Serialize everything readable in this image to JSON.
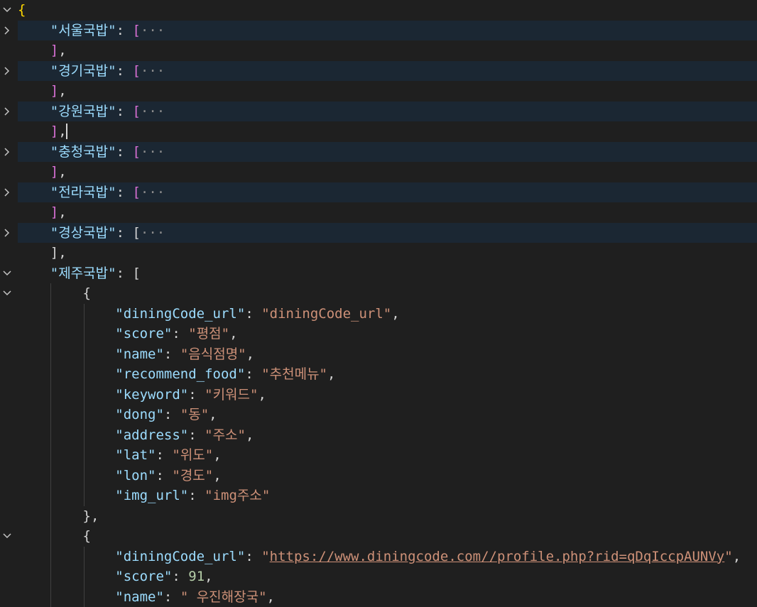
{
  "editor": {
    "lines": [
      {
        "fold": "open",
        "hl": false,
        "tokens": [
          {
            "t": "{",
            "c": "b1"
          }
        ]
      },
      {
        "fold": "closed",
        "hl": true,
        "tokens": [
          {
            "t": "    "
          },
          {
            "t": "\"서울국밥\"",
            "c": "key"
          },
          {
            "t": ": ",
            "c": "punc"
          },
          {
            "t": "[",
            "c": "b2"
          },
          {
            "t": "···",
            "c": "ell"
          }
        ]
      },
      {
        "fold": "",
        "hl": false,
        "tokens": [
          {
            "t": "    "
          },
          {
            "t": "]",
            "c": "b2"
          },
          {
            "t": ",",
            "c": "punc"
          }
        ]
      },
      {
        "fold": "closed",
        "hl": true,
        "tokens": [
          {
            "t": "    "
          },
          {
            "t": "\"경기국밥\"",
            "c": "key"
          },
          {
            "t": ": ",
            "c": "punc"
          },
          {
            "t": "[",
            "c": "b2"
          },
          {
            "t": "···",
            "c": "ell"
          }
        ]
      },
      {
        "fold": "",
        "hl": false,
        "tokens": [
          {
            "t": "    "
          },
          {
            "t": "]",
            "c": "b2"
          },
          {
            "t": ",",
            "c": "punc"
          }
        ]
      },
      {
        "fold": "closed",
        "hl": true,
        "tokens": [
          {
            "t": "    "
          },
          {
            "t": "\"강원국밥\"",
            "c": "key"
          },
          {
            "t": ": ",
            "c": "punc"
          },
          {
            "t": "[",
            "c": "b2"
          },
          {
            "t": "···",
            "c": "ell"
          }
        ]
      },
      {
        "fold": "",
        "hl": false,
        "cursor": true,
        "tokens": [
          {
            "t": "    "
          },
          {
            "t": "]",
            "c": "b2"
          },
          {
            "t": ",",
            "c": "punc"
          }
        ]
      },
      {
        "fold": "closed",
        "hl": true,
        "tokens": [
          {
            "t": "    "
          },
          {
            "t": "\"충청국밥\"",
            "c": "key"
          },
          {
            "t": ": ",
            "c": "punc"
          },
          {
            "t": "[",
            "c": "b2"
          },
          {
            "t": "···",
            "c": "ell"
          }
        ]
      },
      {
        "fold": "",
        "hl": false,
        "tokens": [
          {
            "t": "    "
          },
          {
            "t": "]",
            "c": "b2"
          },
          {
            "t": ",",
            "c": "punc"
          }
        ]
      },
      {
        "fold": "closed",
        "hl": true,
        "tokens": [
          {
            "t": "    "
          },
          {
            "t": "\"전라국밥\"",
            "c": "key"
          },
          {
            "t": ": ",
            "c": "punc"
          },
          {
            "t": "[",
            "c": "b2"
          },
          {
            "t": "···",
            "c": "ell"
          }
        ]
      },
      {
        "fold": "",
        "hl": false,
        "tokens": [
          {
            "t": "    "
          },
          {
            "t": "]",
            "c": "b2"
          },
          {
            "t": ",",
            "c": "punc"
          }
        ]
      },
      {
        "fold": "closed",
        "hl": true,
        "tokens": [
          {
            "t": "    "
          },
          {
            "t": "\"경상국밥\"",
            "c": "key"
          },
          {
            "t": ": ",
            "c": "punc"
          },
          {
            "t": "[",
            "c": "b3"
          },
          {
            "t": "···",
            "c": "ell"
          }
        ]
      },
      {
        "fold": "",
        "hl": false,
        "tokens": [
          {
            "t": "    "
          },
          {
            "t": "]",
            "c": "b3"
          },
          {
            "t": ",",
            "c": "punc"
          }
        ]
      },
      {
        "fold": "open",
        "hl": false,
        "tokens": [
          {
            "t": "    "
          },
          {
            "t": "\"제주국밥\"",
            "c": "key"
          },
          {
            "t": ": ",
            "c": "punc"
          },
          {
            "t": "[",
            "c": "b3"
          }
        ]
      },
      {
        "fold": "open",
        "hl": false,
        "tokens": [
          {
            "t": "        "
          },
          {
            "t": "{",
            "c": "b3"
          }
        ]
      },
      {
        "fold": "",
        "hl": false,
        "tokens": [
          {
            "t": "            "
          },
          {
            "t": "\"diningCode_url\"",
            "c": "key"
          },
          {
            "t": ": ",
            "c": "punc"
          },
          {
            "t": "\"diningCode_url\"",
            "c": "str"
          },
          {
            "t": ",",
            "c": "punc"
          }
        ]
      },
      {
        "fold": "",
        "hl": false,
        "tokens": [
          {
            "t": "            "
          },
          {
            "t": "\"score\"",
            "c": "key"
          },
          {
            "t": ": ",
            "c": "punc"
          },
          {
            "t": "\"평점\"",
            "c": "str"
          },
          {
            "t": ",",
            "c": "punc"
          }
        ]
      },
      {
        "fold": "",
        "hl": false,
        "tokens": [
          {
            "t": "            "
          },
          {
            "t": "\"name\"",
            "c": "key"
          },
          {
            "t": ": ",
            "c": "punc"
          },
          {
            "t": "\"음식점명\"",
            "c": "str"
          },
          {
            "t": ",",
            "c": "punc"
          }
        ]
      },
      {
        "fold": "",
        "hl": false,
        "tokens": [
          {
            "t": "            "
          },
          {
            "t": "\"recommend_food\"",
            "c": "key"
          },
          {
            "t": ": ",
            "c": "punc"
          },
          {
            "t": "\"추천메뉴\"",
            "c": "str"
          },
          {
            "t": ",",
            "c": "punc"
          }
        ]
      },
      {
        "fold": "",
        "hl": false,
        "tokens": [
          {
            "t": "            "
          },
          {
            "t": "\"keyword\"",
            "c": "key"
          },
          {
            "t": ": ",
            "c": "punc"
          },
          {
            "t": "\"키워드\"",
            "c": "str"
          },
          {
            "t": ",",
            "c": "punc"
          }
        ]
      },
      {
        "fold": "",
        "hl": false,
        "tokens": [
          {
            "t": "            "
          },
          {
            "t": "\"dong\"",
            "c": "key"
          },
          {
            "t": ": ",
            "c": "punc"
          },
          {
            "t": "\"동\"",
            "c": "str"
          },
          {
            "t": ",",
            "c": "punc"
          }
        ]
      },
      {
        "fold": "",
        "hl": false,
        "tokens": [
          {
            "t": "            "
          },
          {
            "t": "\"address\"",
            "c": "key"
          },
          {
            "t": ": ",
            "c": "punc"
          },
          {
            "t": "\"주소\"",
            "c": "str"
          },
          {
            "t": ",",
            "c": "punc"
          }
        ]
      },
      {
        "fold": "",
        "hl": false,
        "tokens": [
          {
            "t": "            "
          },
          {
            "t": "\"lat\"",
            "c": "key"
          },
          {
            "t": ": ",
            "c": "punc"
          },
          {
            "t": "\"위도\"",
            "c": "str"
          },
          {
            "t": ",",
            "c": "punc"
          }
        ]
      },
      {
        "fold": "",
        "hl": false,
        "tokens": [
          {
            "t": "            "
          },
          {
            "t": "\"lon\"",
            "c": "key"
          },
          {
            "t": ": ",
            "c": "punc"
          },
          {
            "t": "\"경도\"",
            "c": "str"
          },
          {
            "t": ",",
            "c": "punc"
          }
        ]
      },
      {
        "fold": "",
        "hl": false,
        "tokens": [
          {
            "t": "            "
          },
          {
            "t": "\"img_url\"",
            "c": "key"
          },
          {
            "t": ": ",
            "c": "punc"
          },
          {
            "t": "\"img주소\"",
            "c": "str"
          }
        ]
      },
      {
        "fold": "",
        "hl": false,
        "tokens": [
          {
            "t": "        "
          },
          {
            "t": "}",
            "c": "b3"
          },
          {
            "t": ",",
            "c": "punc"
          }
        ]
      },
      {
        "fold": "open",
        "hl": false,
        "tokens": [
          {
            "t": "        "
          },
          {
            "t": "{",
            "c": "b3"
          }
        ]
      },
      {
        "fold": "",
        "hl": false,
        "tokens": [
          {
            "t": "            "
          },
          {
            "t": "\"diningCode_url\"",
            "c": "key"
          },
          {
            "t": ": ",
            "c": "punc"
          },
          {
            "t": "\"",
            "c": "str"
          },
          {
            "t": "https://www.diningcode.com//profile.php?rid=qDqIccpAUNVy",
            "c": "link"
          },
          {
            "t": "\"",
            "c": "str"
          },
          {
            "t": ",",
            "c": "punc"
          }
        ]
      },
      {
        "fold": "",
        "hl": false,
        "tokens": [
          {
            "t": "            "
          },
          {
            "t": "\"score\"",
            "c": "key"
          },
          {
            "t": ": ",
            "c": "punc"
          },
          {
            "t": "91",
            "c": "num"
          },
          {
            "t": ",",
            "c": "punc"
          }
        ]
      },
      {
        "fold": "",
        "hl": false,
        "tokens": [
          {
            "t": "            "
          },
          {
            "t": "\"name\"",
            "c": "key"
          },
          {
            "t": ": ",
            "c": "punc"
          },
          {
            "t": "\" 우진해장국\"",
            "c": "str"
          },
          {
            "t": ",",
            "c": "punc"
          }
        ]
      }
    ]
  }
}
